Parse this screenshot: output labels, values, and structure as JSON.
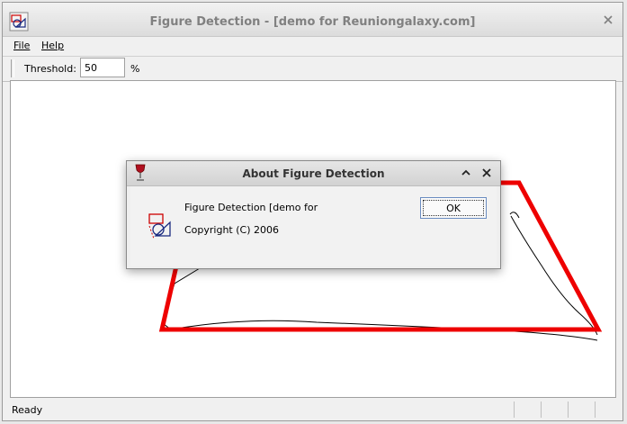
{
  "window": {
    "title": "Figure Detection - [demo for Reuniongalaxy.com]"
  },
  "menu": {
    "file_label": "File",
    "help_label": "Help"
  },
  "toolbar": {
    "threshold_label": "Threshold:",
    "threshold_value": "50",
    "percent_label": "%"
  },
  "status": {
    "text": "Ready"
  },
  "dialog": {
    "title": "About Figure Detection",
    "line1": "Figure Detection [demo for",
    "line2": "Copyright (C) 2006",
    "ok_label": "OK"
  },
  "colors": {
    "detected_shape": "#ee0000",
    "sketch_stroke": "#000000"
  },
  "icons": [
    "app-icon",
    "close-icon",
    "wine-glass-icon",
    "chevron-up-icon",
    "logo-icon"
  ]
}
